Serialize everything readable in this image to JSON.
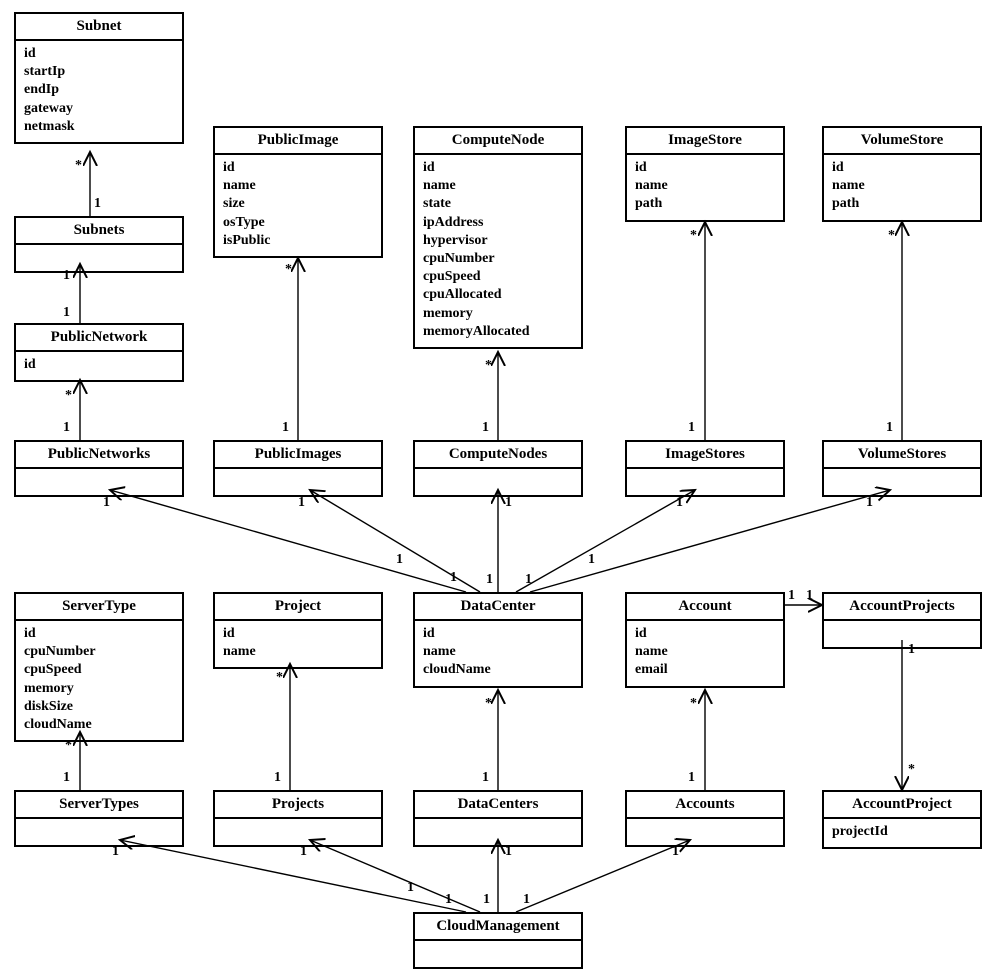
{
  "classes": {
    "Subnet": {
      "title": "Subnet",
      "attrs": [
        "id",
        "startIp",
        "endIp",
        "gateway",
        "netmask"
      ]
    },
    "Subnets": {
      "title": "Subnets",
      "attrs": []
    },
    "PublicNetwork": {
      "title": "PublicNetwork",
      "attrs": [
        "id"
      ]
    },
    "PublicNetworks": {
      "title": "PublicNetworks",
      "attrs": []
    },
    "PublicImage": {
      "title": "PublicImage",
      "attrs": [
        "id",
        "name",
        "size",
        "osType",
        "isPublic"
      ]
    },
    "PublicImages": {
      "title": "PublicImages",
      "attrs": []
    },
    "ComputeNode": {
      "title": "ComputeNode",
      "attrs": [
        "id",
        "name",
        "state",
        "ipAddress",
        "hypervisor",
        "cpuNumber",
        "cpuSpeed",
        "cpuAllocated",
        "memory",
        "memoryAllocated"
      ]
    },
    "ComputeNodes": {
      "title": "ComputeNodes",
      "attrs": []
    },
    "ImageStore": {
      "title": "ImageStore",
      "attrs": [
        "id",
        "name",
        "path"
      ]
    },
    "ImageStores": {
      "title": "ImageStores",
      "attrs": []
    },
    "VolumeStore": {
      "title": "VolumeStore",
      "attrs": [
        "id",
        "name",
        "path"
      ]
    },
    "VolumeStores": {
      "title": "VolumeStores",
      "attrs": []
    },
    "ServerType": {
      "title": "ServerType",
      "attrs": [
        "id",
        "cpuNumber",
        "cpuSpeed",
        "memory",
        "diskSize",
        "cloudName"
      ]
    },
    "ServerTypes": {
      "title": "ServerTypes",
      "attrs": []
    },
    "Project": {
      "title": "Project",
      "attrs": [
        "id",
        "name"
      ]
    },
    "Projects": {
      "title": "Projects",
      "attrs": []
    },
    "DataCenter": {
      "title": "DataCenter",
      "attrs": [
        "id",
        "name",
        "cloudName"
      ]
    },
    "DataCenters": {
      "title": "DataCenters",
      "attrs": []
    },
    "Account": {
      "title": "Account",
      "attrs": [
        "id",
        "name",
        "email"
      ]
    },
    "Accounts": {
      "title": "Accounts",
      "attrs": []
    },
    "AccountProjects": {
      "title": "AccountProjects",
      "attrs": []
    },
    "AccountProject": {
      "title": "AccountProject",
      "attrs": [
        "projectId"
      ]
    },
    "CloudManagement": {
      "title": "CloudManagement",
      "attrs": []
    }
  },
  "mult": {
    "one": "1",
    "many": "*"
  }
}
